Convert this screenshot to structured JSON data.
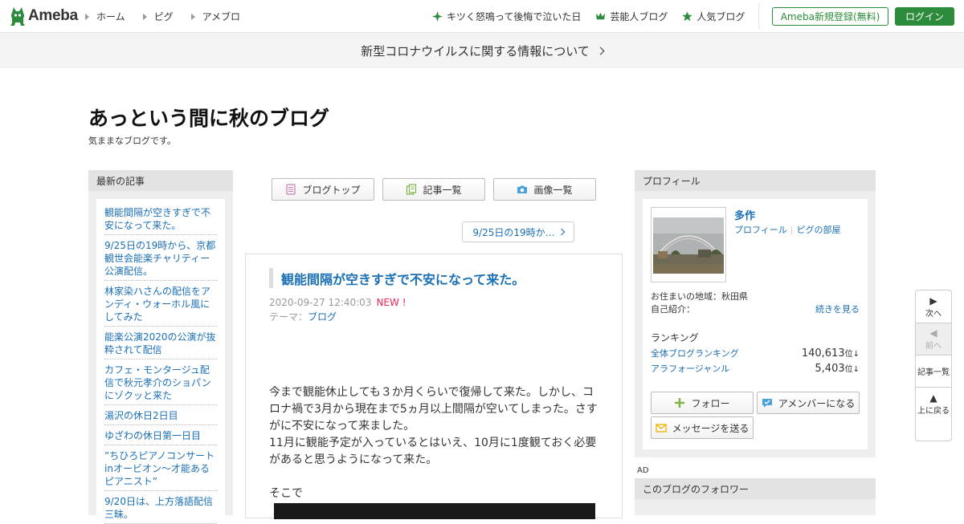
{
  "header": {
    "logo_text": "Ameba",
    "nav_left": [
      "ホーム",
      "ピグ",
      "アメブロ"
    ],
    "nav_right": [
      {
        "label": "キツく怒鳴って後悔で泣いた日",
        "icon": "sparkle-icon"
      },
      {
        "label": "芸能人ブログ",
        "icon": "crown-icon"
      },
      {
        "label": "人気ブログ",
        "icon": "star-icon"
      }
    ],
    "register_label": "Ameba新規登録(無料)",
    "login_label": "ログイン",
    "brand_color": "#2d8c3c"
  },
  "notice": {
    "text": "新型コロナウイルスに関する情報について"
  },
  "blog": {
    "title": "あっという間に秋のブログ",
    "description": "気ままなブログです。"
  },
  "left_sidebar": {
    "heading": "最新の記事",
    "articles": [
      "観能間隔が空きすぎで不安になって来た。",
      "9/25日の19時から、京都観世会能楽チャリティー公演配信。",
      "林家染ハさんの配信をアンディ・ウォーホル風にしてみた",
      "能楽公演2020の公演が抜粋されて配信",
      "カフェ・モンタージュ配信で秋元孝介のショパンにゾクッと来た",
      "湯沢の休日2日目",
      "ゆざわの休日第一日目",
      "”ちひろピアノコンサートinオービオン〜才能あるピアニスト”",
      "9/20日は、上方落語配信三昧。"
    ]
  },
  "center": {
    "nav_buttons": [
      {
        "label": "ブログトップ",
        "icon": "blog-top-icon"
      },
      {
        "label": "記事一覧",
        "icon": "article-list-icon"
      },
      {
        "label": "画像一覧",
        "icon": "camera-icon"
      }
    ],
    "next_post_label": "9/25日の19時か…",
    "entry": {
      "title": "観能間隔が空きすぎで不安になって来た。",
      "date": "2020-09-27 12:40:03",
      "new_badge": "NEW !",
      "theme_label": "テーマ：",
      "theme": "ブログ",
      "paragraphs": [
        "今まで観能休止しても３か月くらいで復帰して来た。しかし、コロナ禍で3月から現在まで5ヵ月以上間隔が空いてしまった。さすがに不安になって来ました。",
        "11月に観能予定が入っているとはいえ、10月に1度観ておく必要があると思うようになって来た。",
        "",
        "そこで"
      ]
    }
  },
  "profile": {
    "heading": "プロフィール",
    "name": "多作",
    "links": [
      "プロフィール",
      "ピグの部屋"
    ],
    "location_label": "お住まいの地域：秋田県",
    "intro_label": "自己紹介：",
    "more_label": "続きを見る",
    "ranking_heading": "ランキング",
    "rankings": [
      {
        "label": "全体ブログランキング",
        "value": "140,613",
        "unit": "位",
        "trend": "↓"
      },
      {
        "label": "アラフォージャンル",
        "value": "5,403",
        "unit": "位",
        "trend": "↓"
      }
    ],
    "follow_label": "フォロー",
    "amember_label": "アメンバーになる",
    "message_label": "メッセージを送る"
  },
  "ad_label": "AD",
  "followers_heading": "このブログのフォロワー",
  "floating_nav": {
    "next": "次へ",
    "prev": "前へ",
    "list": "記事一覧",
    "top": "上に戻る"
  }
}
